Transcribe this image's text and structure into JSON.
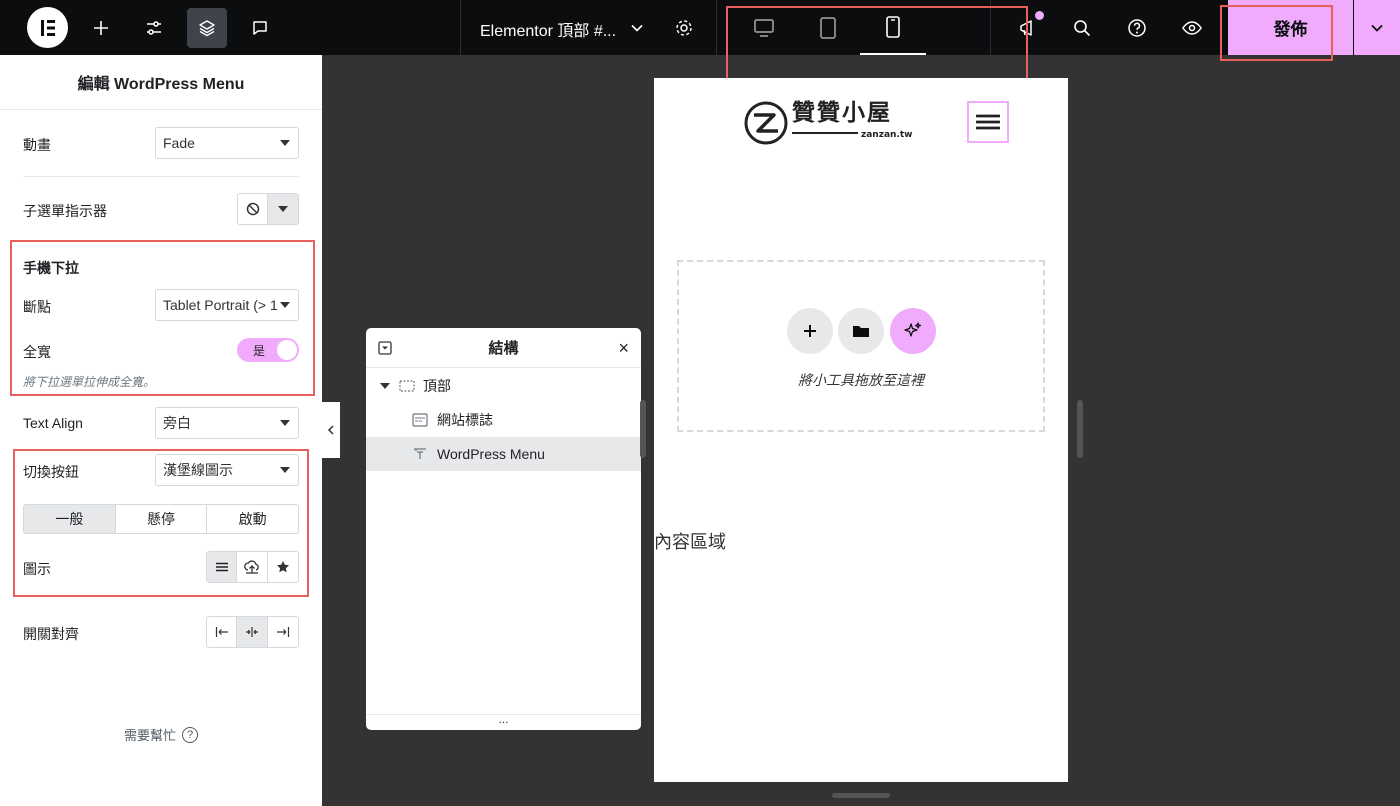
{
  "topbar": {
    "document_title": "Elementor 頂部 #...",
    "publish_label": "發佈"
  },
  "panel": {
    "title": "編輯 WordPress Menu",
    "animation": {
      "label": "動畫",
      "value": "Fade"
    },
    "submenu_indicator": {
      "label": "子選單指示器"
    },
    "mobile_dropdown": {
      "heading": "手機下拉",
      "breakpoint": {
        "label": "斷點",
        "value": "Tablet Portrait (> 1"
      },
      "full_width": {
        "label": "全寬",
        "toggle_text": "是",
        "hint": "將下拉選單拉伸成全寬。"
      }
    },
    "text_align": {
      "label": "Text Align",
      "value": "旁白"
    },
    "toggle_button": {
      "label": "切換按鈕",
      "value": "漢堡線圖示",
      "tabs": [
        "一般",
        "懸停",
        "啟動"
      ],
      "icon_label": "圖示"
    },
    "toggle_align": {
      "label": "開關對齊"
    },
    "help": "需要幫忙"
  },
  "navigator": {
    "title": "結構",
    "items": [
      {
        "label": "頂部"
      },
      {
        "label": "網站標誌"
      },
      {
        "label": "WordPress Menu"
      }
    ]
  },
  "preview": {
    "logo_title": "贊贊小屋",
    "logo_sub": "zanzan.tw",
    "drop_text": "將小工具拖放至這裡",
    "content_area": "內容區域"
  },
  "colors": {
    "accent": "#f0abfc",
    "highlight_box": "#e8605b",
    "topbar": "#0c0d0e"
  }
}
